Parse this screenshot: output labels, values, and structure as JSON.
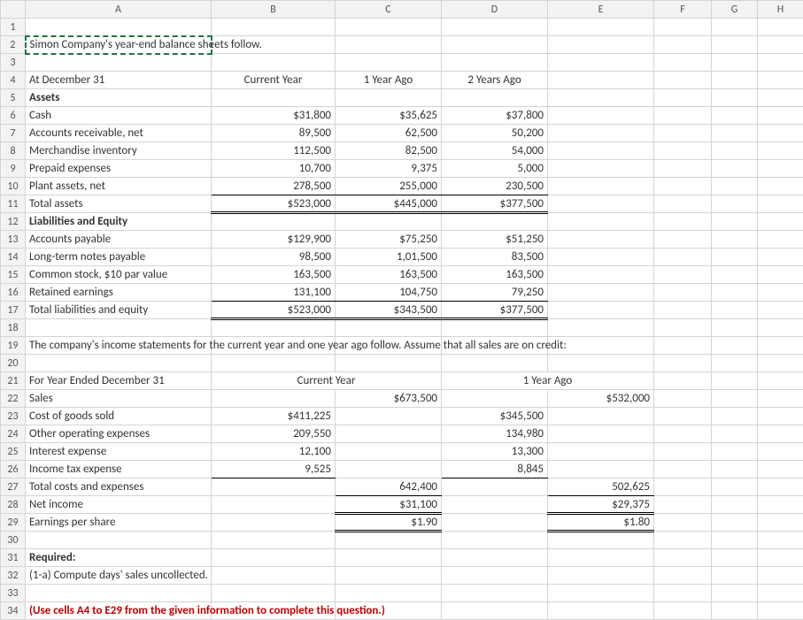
{
  "cols": [
    "A",
    "B",
    "C",
    "D",
    "E",
    "F",
    "G",
    "H"
  ],
  "r2": {
    "a": "Simon Company's year-end balance sheets follow."
  },
  "r4": {
    "a": "At December 31",
    "b": "Current Year",
    "c": "1 Year Ago",
    "d": "2 Years Ago"
  },
  "r5": {
    "a": "Assets"
  },
  "r6": {
    "a": "Cash",
    "b": "$31,800",
    "c": "$35,625",
    "d": "$37,800"
  },
  "r7": {
    "a": "Accounts receivable, net",
    "b": "89,500",
    "c": "62,500",
    "d": "50,200"
  },
  "r8": {
    "a": "Merchandise inventory",
    "b": "112,500",
    "c": "82,500",
    "d": "54,000"
  },
  "r9": {
    "a": "Prepaid expenses",
    "b": "10,700",
    "c": "9,375",
    "d": "5,000"
  },
  "r10": {
    "a": "Plant assets, net",
    "b": "278,500",
    "c": "255,000",
    "d": "230,500"
  },
  "r11": {
    "a": "Total assets",
    "b": "$523,000",
    "c": "$445,000",
    "d": "$377,500"
  },
  "r12": {
    "a": "Liabilities and Equity"
  },
  "r13": {
    "a": "Accounts payable",
    "b": "$129,900",
    "c": "$75,250",
    "d": "$51,250"
  },
  "r14": {
    "a": "Long-term notes payable",
    "b": "98,500",
    "c": "1,01,500",
    "d": "83,500"
  },
  "r15": {
    "a": "Common stock, $10 par value",
    "b": "163,500",
    "c": "163,500",
    "d": "163,500"
  },
  "r16": {
    "a": "Retained earnings",
    "b": "131,100",
    "c": "104,750",
    "d": "79,250"
  },
  "r17": {
    "a": "Total liabilities and equity",
    "b": "$523,000",
    "c": "$343,500",
    "d": "$377,500"
  },
  "r19": {
    "a": "The company's income statements for the current year and one year ago follow. Assume that all sales are on credit:"
  },
  "r21": {
    "a": "For Year Ended December 31",
    "bc": "Current Year",
    "de": "1 Year Ago"
  },
  "r22": {
    "a": "Sales",
    "c": "$673,500",
    "e": "$532,000"
  },
  "r23": {
    "a": "Cost of goods sold",
    "b": "$411,225",
    "d": "$345,500"
  },
  "r24": {
    "a": "Other operating expenses",
    "b": "209,550",
    "d": "134,980"
  },
  "r25": {
    "a": "Interest expense",
    "b": "12,100",
    "d": "13,300"
  },
  "r26": {
    "a": "Income tax expense",
    "b": "9,525",
    "d": "8,845"
  },
  "r27": {
    "a": "Total costs and expenses",
    "c": "642,400",
    "e": "502,625"
  },
  "r28": {
    "a": "Net income",
    "c": "$31,100",
    "e": "$29,375"
  },
  "r29": {
    "a": "Earnings per share",
    "c": "$1.90",
    "e": "$1.80"
  },
  "r31": {
    "a": "Required:"
  },
  "r32": {
    "a": "(1-a) Compute days' sales uncollected."
  },
  "r34": {
    "a": "(Use cells A4 to E29 from the given information to complete this question.)"
  }
}
